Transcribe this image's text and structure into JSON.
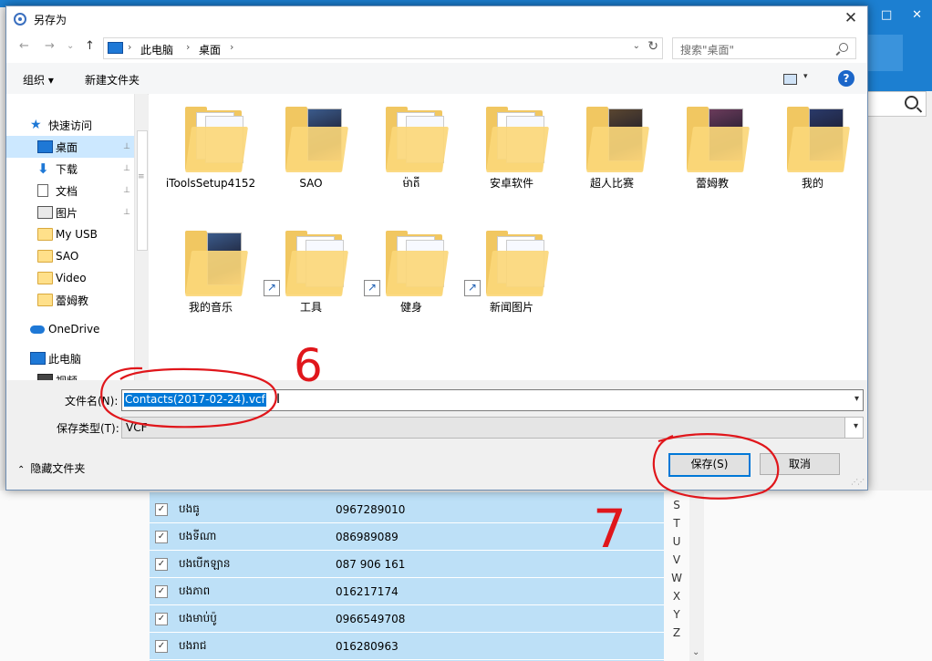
{
  "background_app": {
    "win_buttons": [
      "□",
      "✕"
    ],
    "contacts": [
      {
        "name": "បងធូ",
        "phone": "0967289010"
      },
      {
        "name": "បងទីណា",
        "phone": "086989089"
      },
      {
        "name": "បងបើកឡាន",
        "phone": "087 906 161"
      },
      {
        "name": "បងភាព",
        "phone": "016217174"
      },
      {
        "name": "បងមាប់ប៉ូ",
        "phone": "0966549708"
      },
      {
        "name": "បងរាជ",
        "phone": "016280963"
      }
    ],
    "alphabet": [
      "S",
      "T",
      "U",
      "V",
      "W",
      "X",
      "Y",
      "Z"
    ],
    "checkbox_mark": "✓"
  },
  "dialog": {
    "title": "另存为",
    "close_glyph": "✕",
    "nav": {
      "back": "←",
      "forward": "→",
      "recent": "⌄",
      "up": "↑",
      "breadcrumb": [
        "此电脑",
        "桌面"
      ],
      "separator": "›",
      "address_dropdown": "⌄",
      "refresh": "↻",
      "search_placeholder": "搜索\"桌面\""
    },
    "command_bar": {
      "organize": "组织 ▾",
      "new_folder": "新建文件夹",
      "view_dropdown": "▾",
      "help": "?"
    },
    "nav_pane": [
      {
        "label": "快速访问",
        "icon": "star-icon",
        "pinned": false
      },
      {
        "label": "桌面",
        "icon": "desktop-icon",
        "pinned": true,
        "selected": true
      },
      {
        "label": "下载",
        "icon": "download-icon",
        "pinned": true
      },
      {
        "label": "文档",
        "icon": "document-icon",
        "pinned": true
      },
      {
        "label": "图片",
        "icon": "picture-icon",
        "pinned": true
      },
      {
        "label": "My USB",
        "icon": "folder-icon",
        "pinned": false
      },
      {
        "label": "SAO",
        "icon": "folder-icon",
        "pinned": false
      },
      {
        "label": "Video",
        "icon": "folder-icon",
        "pinned": false
      },
      {
        "label": "蕾姆教",
        "icon": "folder-icon",
        "pinned": false
      },
      {
        "label": "OneDrive",
        "icon": "onedrive-icon",
        "pinned": false
      },
      {
        "label": "此电脑",
        "icon": "computer-icon",
        "pinned": false
      },
      {
        "label": "视频",
        "icon": "video-icon",
        "pinned": false
      }
    ],
    "pin_glyph": "📌",
    "shortcut_glyph": "↗",
    "files": [
      {
        "label": "iToolsSetup4152",
        "kind": "paper",
        "shortcut": false
      },
      {
        "label": "SAO",
        "kind": "image",
        "shortcut": false
      },
      {
        "label": "ម៉ាតី",
        "kind": "paper",
        "shortcut": false
      },
      {
        "label": "安卓软件",
        "kind": "paper",
        "shortcut": false
      },
      {
        "label": "超人比赛",
        "kind": "image",
        "shortcut": false
      },
      {
        "label": "蕾姆教",
        "kind": "image",
        "shortcut": false
      },
      {
        "label": "我的",
        "kind": "image",
        "shortcut": false
      },
      {
        "label": "我的音乐",
        "kind": "image",
        "shortcut": false
      },
      {
        "label": "工具",
        "kind": "paper",
        "shortcut": true
      },
      {
        "label": "健身",
        "kind": "paper",
        "shortcut": true
      },
      {
        "label": "新闻图片",
        "kind": "paper",
        "shortcut": true
      }
    ],
    "filename_label": "文件名(N):",
    "filename_value": "Contacts(2017-02-24).vcf",
    "filetype_label": "保存类型(T):",
    "filetype_value": "VCF",
    "hide_folders": "隐藏文件夹",
    "hide_glyph": "⌃",
    "dropdown_glyph": "▾",
    "save_button": "保存(S)",
    "cancel_button": "取消"
  },
  "annotations": {
    "step6": "6",
    "step7": "7",
    "color": "#e0161b"
  }
}
